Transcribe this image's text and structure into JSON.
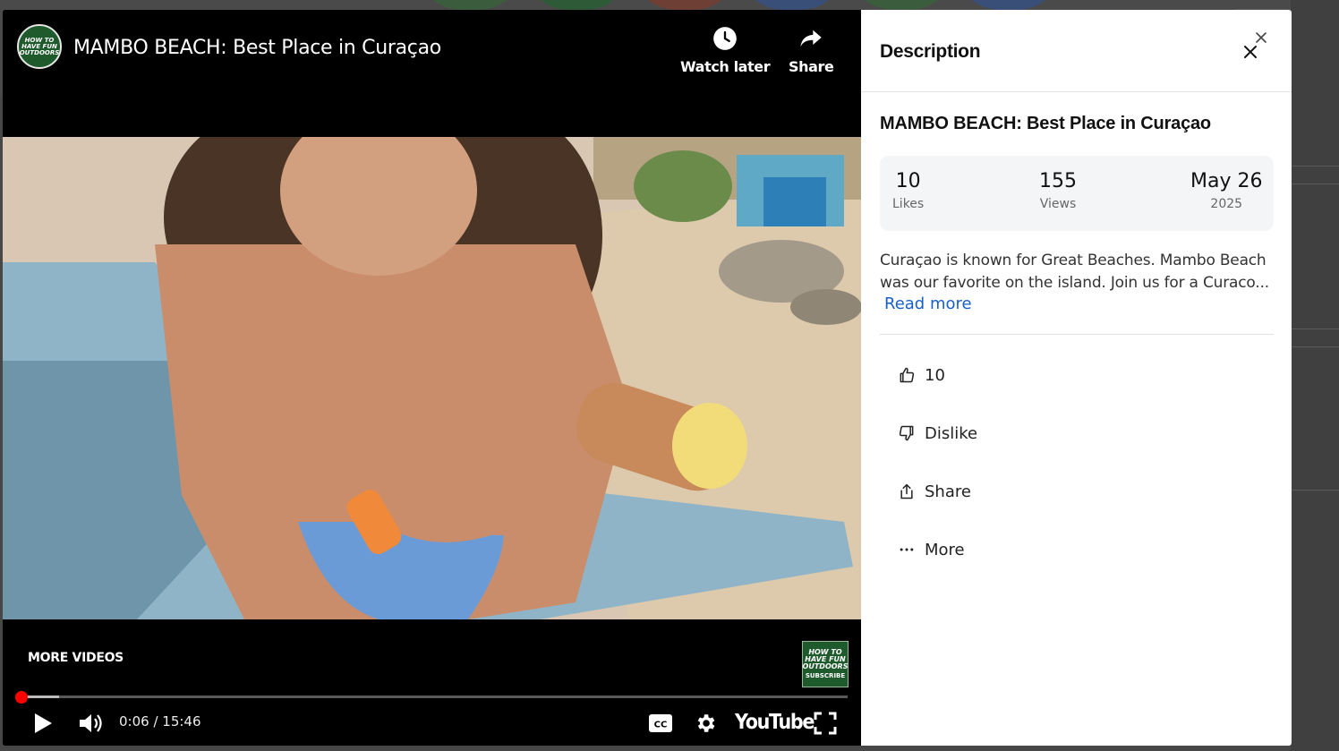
{
  "video": {
    "title": "MAMBO BEACH: Best Place in Curaçao",
    "channel_logo_text": "HOW TO HAVE FUN OUTDOORS",
    "watch_later_label": "Watch later",
    "share_label": "Share",
    "more_videos_label": "MORE VIDEOS",
    "subscribe_logo_text": "HOW TO HAVE FUN OUTDOORS",
    "subscribe_label": "SUBSCRIBE",
    "current_time": "0:06",
    "duration": "15:46",
    "time_display": "0:06 / 15:46",
    "progress_fraction": 0.0063,
    "buffered_fraction": 0.045,
    "youtube_logo": "YouTube",
    "icons": [
      "play-icon",
      "volume-icon",
      "captions-icon",
      "settings-icon",
      "fullscreen-icon",
      "clock-icon",
      "share-arrow-icon"
    ]
  },
  "panel": {
    "heading": "Description",
    "video_title": "MAMBO BEACH: Best Place in Curaçao",
    "stats": {
      "likes_value": "10",
      "likes_label": "Likes",
      "views_value": "155",
      "views_label": "Views",
      "date_value": "May 26",
      "date_year": "2025"
    },
    "description": "Curaçao is known for Great Beaches. Mambo Beach was our favorite on the island. Join us for a Curaco...",
    "read_more": "Read more",
    "actions": {
      "like_count": "10",
      "dislike": "Dislike",
      "share": "Share",
      "more": "More"
    }
  },
  "colors": {
    "progress_played": "#ff0000",
    "link": "#1a5fc8",
    "channel_green": "#1f5a2d"
  }
}
